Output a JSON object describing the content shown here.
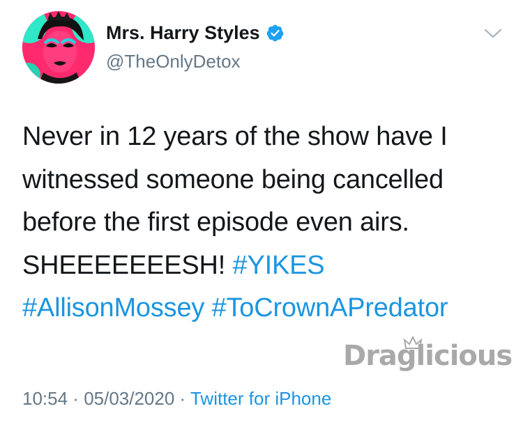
{
  "author": {
    "display_name": "Mrs. Harry Styles",
    "handle": "@TheOnlyDetox",
    "verified": true,
    "verified_icon": "verified-badge-icon"
  },
  "menu_icon": "chevron-down-icon",
  "tweet": {
    "lines": [
      [
        {
          "text": "Never in 12 years of the show have I",
          "type": "text"
        }
      ],
      [
        {
          "text": "witnessed someone being cancelled",
          "type": "text"
        }
      ],
      [
        {
          "text": "before the first episode even airs.",
          "type": "text"
        }
      ],
      [
        {
          "text": "SHEEEEEEESH! ",
          "type": "text"
        },
        {
          "text": "#YIKES",
          "type": "hashtag"
        }
      ],
      [
        {
          "text": "#AllisonMossey",
          "type": "hashtag"
        },
        {
          "text": " ",
          "type": "text"
        },
        {
          "text": "#ToCrownAPredator",
          "type": "hashtag"
        }
      ]
    ]
  },
  "meta": {
    "time": "10:54",
    "separator": " · ",
    "date": "05/03/2020",
    "source": "Twitter for iPhone"
  },
  "watermark": {
    "text": "Draglicious"
  },
  "colors": {
    "link": "#1b95e0",
    "verified": "#1da1f2",
    "secondary_text": "#657786",
    "primary_text": "#14171a"
  }
}
